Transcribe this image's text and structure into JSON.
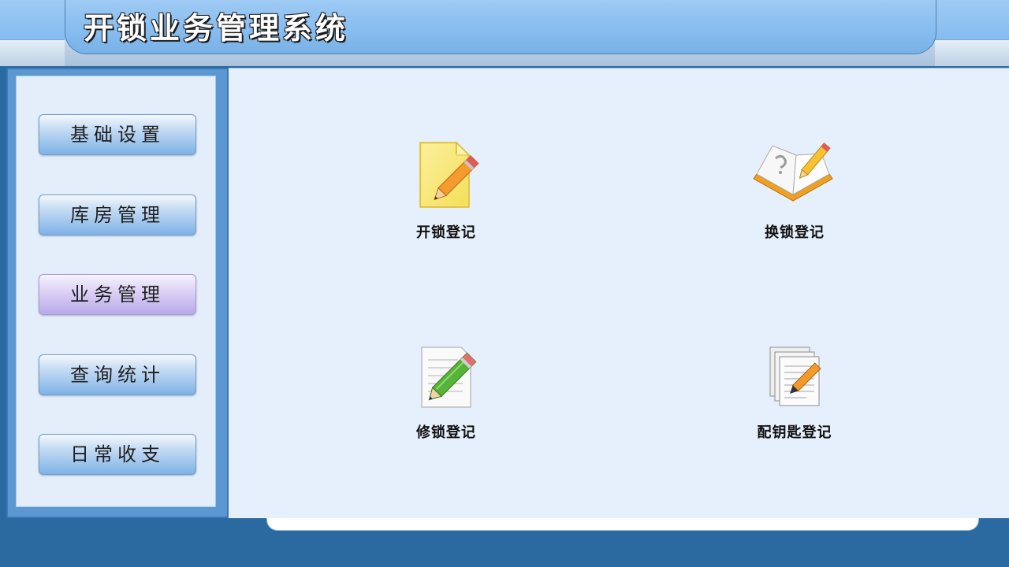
{
  "header": {
    "title": "开锁业务管理系统"
  },
  "sidebar": {
    "items": [
      {
        "label": "基础设置"
      },
      {
        "label": "库房管理"
      },
      {
        "label": "业务管理"
      },
      {
        "label": "查询统计"
      },
      {
        "label": "日常收支"
      }
    ],
    "active_index": 2
  },
  "main": {
    "tiles": [
      {
        "label": "开锁登记",
        "icon": "note-pencil-icon"
      },
      {
        "label": "换锁登记",
        "icon": "open-book-pencil-icon"
      },
      {
        "label": "修锁登记",
        "icon": "document-pencil-icon"
      },
      {
        "label": "配钥匙登记",
        "icon": "stacked-documents-pen-icon"
      }
    ]
  },
  "colors": {
    "header_blue": "#86bcef",
    "nav_button_blue": "#7eb2e6",
    "nav_button_active": "#b8a9e9",
    "content_bg": "#e6f0fc",
    "frame_dark": "#2a6aa0"
  }
}
